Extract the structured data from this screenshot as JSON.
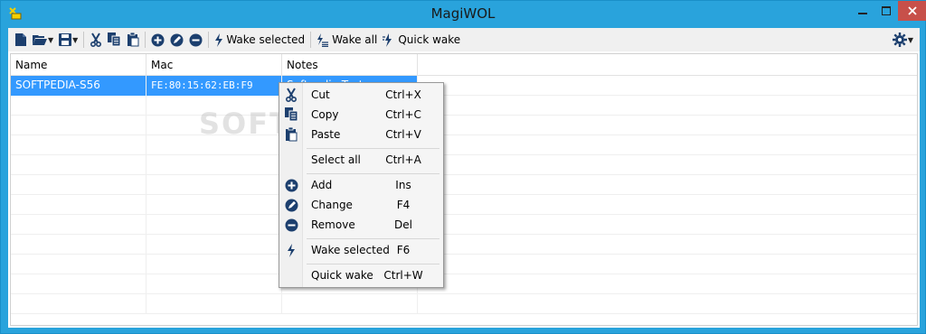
{
  "window": {
    "title": "MagiWOL"
  },
  "toolbar": {
    "wake_selected": "Wake selected",
    "wake_all": "Wake all",
    "quick_wake": "Quick wake"
  },
  "grid": {
    "columns": [
      "Name",
      "Mac",
      "Notes"
    ],
    "rows": [
      {
        "name": "SOFTPEDIA-S56",
        "mac": "FE:80:15:62:EB:F9",
        "notes": "Softpedia Test"
      }
    ]
  },
  "watermark": "SOFTPEDIA",
  "context_menu": {
    "items": [
      {
        "label": "Cut",
        "shortcut": "Ctrl+X",
        "icon": "scissors-icon"
      },
      {
        "label": "Copy",
        "shortcut": "Ctrl+C",
        "icon": "copy-icon"
      },
      {
        "label": "Paste",
        "shortcut": "Ctrl+V",
        "icon": "paste-icon"
      },
      {
        "label": "Select all",
        "shortcut": "Ctrl+A",
        "icon": ""
      },
      {
        "label": "Add",
        "shortcut": "Ins",
        "icon": "add-icon"
      },
      {
        "label": "Change",
        "shortcut": "F4",
        "icon": "edit-icon"
      },
      {
        "label": "Remove",
        "shortcut": "Del",
        "icon": "remove-icon"
      },
      {
        "label": "Wake selected",
        "shortcut": "F6",
        "icon": "bolt-icon"
      },
      {
        "label": "Quick wake",
        "shortcut": "Ctrl+W",
        "icon": ""
      }
    ]
  },
  "colors": {
    "titlebar": "#29a3dc",
    "selection": "#3399ff",
    "close_button": "#c7504a",
    "icon_dark": "#1c3f6e"
  }
}
